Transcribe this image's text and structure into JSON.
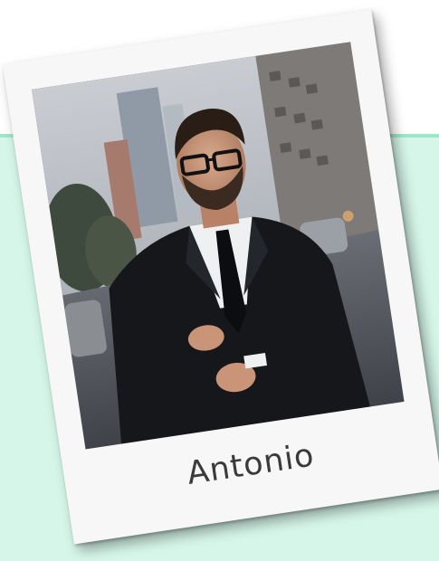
{
  "card": {
    "name": "Antonio",
    "photo_subject": "man-in-suit-with-glasses"
  },
  "colors": {
    "background": "#ffffff",
    "panel": "#d6f6ea",
    "panel_border": "#9fe7cc",
    "card": "#f7f7f7",
    "caption_text": "#3a3a3a"
  }
}
